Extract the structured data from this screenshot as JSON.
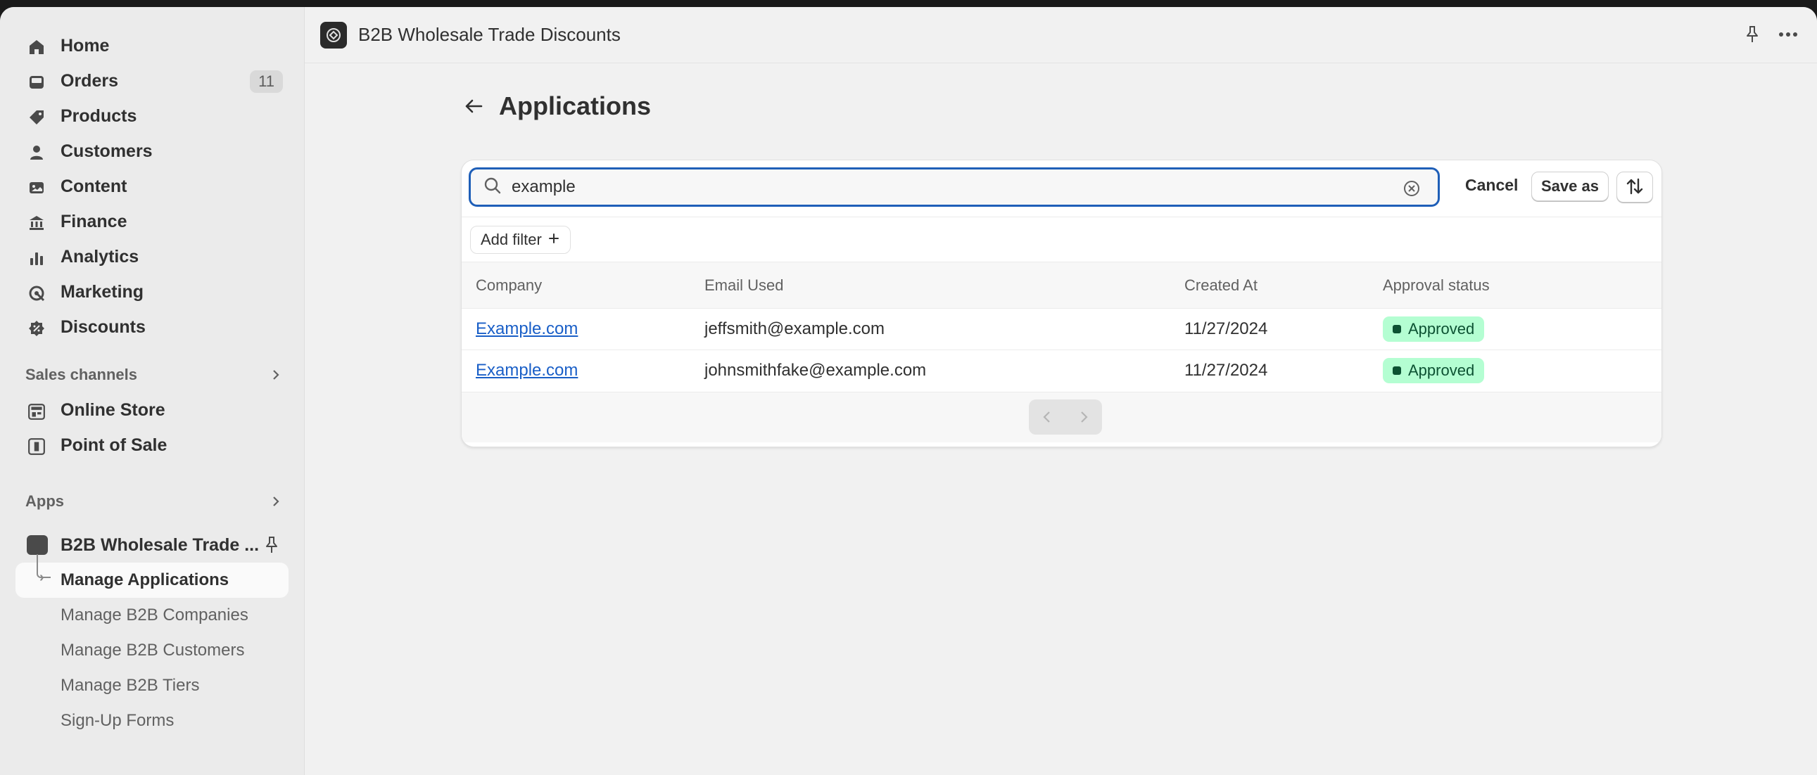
{
  "sidebar": {
    "nav": [
      {
        "label": "Home",
        "icon": "home-icon"
      },
      {
        "label": "Orders",
        "icon": "inbox-icon",
        "badge": "11"
      },
      {
        "label": "Products",
        "icon": "tag-icon"
      },
      {
        "label": "Customers",
        "icon": "person-icon"
      },
      {
        "label": "Content",
        "icon": "image-icon"
      },
      {
        "label": "Finance",
        "icon": "bank-icon"
      },
      {
        "label": "Analytics",
        "icon": "bar-chart-icon"
      },
      {
        "label": "Marketing",
        "icon": "target-icon"
      },
      {
        "label": "Discounts",
        "icon": "discount-icon"
      }
    ],
    "sales_channels": {
      "label": "Sales channels",
      "items": [
        {
          "label": "Online Store",
          "icon": "store-icon"
        },
        {
          "label": "Point of Sale",
          "icon": "pos-icon"
        }
      ]
    },
    "apps": {
      "label": "Apps",
      "app_name": "B2B Wholesale Trade ...",
      "items": [
        "Manage Applications",
        "Manage B2B Companies",
        "Manage B2B Customers",
        "Manage B2B Tiers",
        "Sign-Up Forms"
      ]
    }
  },
  "topbar": {
    "title": "B2B Wholesale Trade Discounts"
  },
  "page": {
    "title": "Applications"
  },
  "search": {
    "value": "example",
    "placeholder": ""
  },
  "actions": {
    "cancel": "Cancel",
    "save_as": "Save as"
  },
  "filter": {
    "add_label": "Add filter"
  },
  "table": {
    "columns": [
      "Company",
      "Email Used",
      "Created At",
      "Approval status"
    ],
    "rows": [
      {
        "company": "Example.com",
        "email": "jeffsmith@example.com",
        "created": "11/27/2024",
        "status": "Approved"
      },
      {
        "company": "Example.com",
        "email": "johnsmithfake@example.com",
        "created": "11/27/2024",
        "status": "Approved"
      }
    ]
  },
  "colors": {
    "accent": "#1f5fb8",
    "status_bg": "#b4fed2",
    "status_text": "#0c5132"
  }
}
